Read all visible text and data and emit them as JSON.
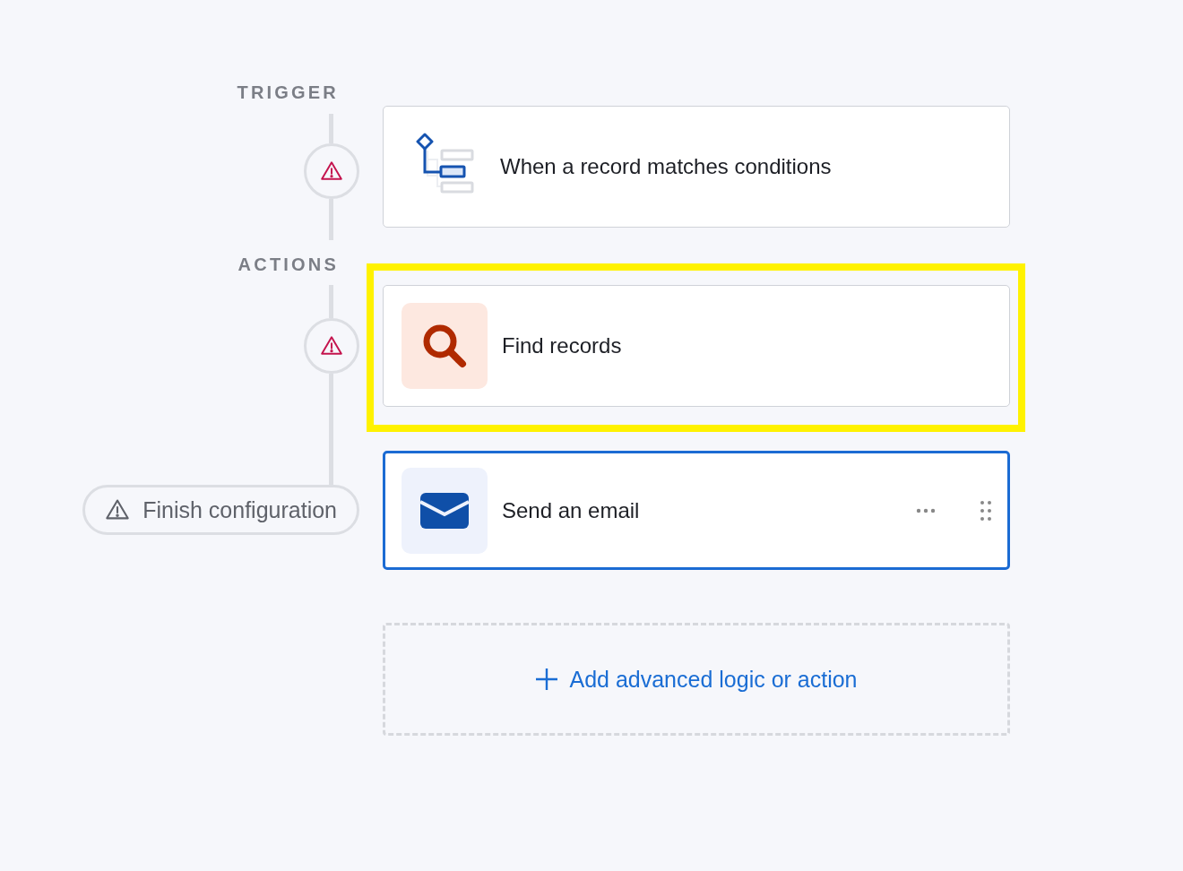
{
  "trigger": {
    "label": "TRIGGER",
    "title": "When a record matches conditions",
    "warning": true
  },
  "actions": {
    "label": "ACTIONS",
    "items": [
      {
        "kind": "find",
        "title": "Find records",
        "selected": false,
        "highlighted": true
      },
      {
        "kind": "email",
        "title": "Send an email",
        "selected": true,
        "highlighted": false
      }
    ]
  },
  "finish_button": "Finish configuration",
  "add_button": "Add advanced logic or action"
}
